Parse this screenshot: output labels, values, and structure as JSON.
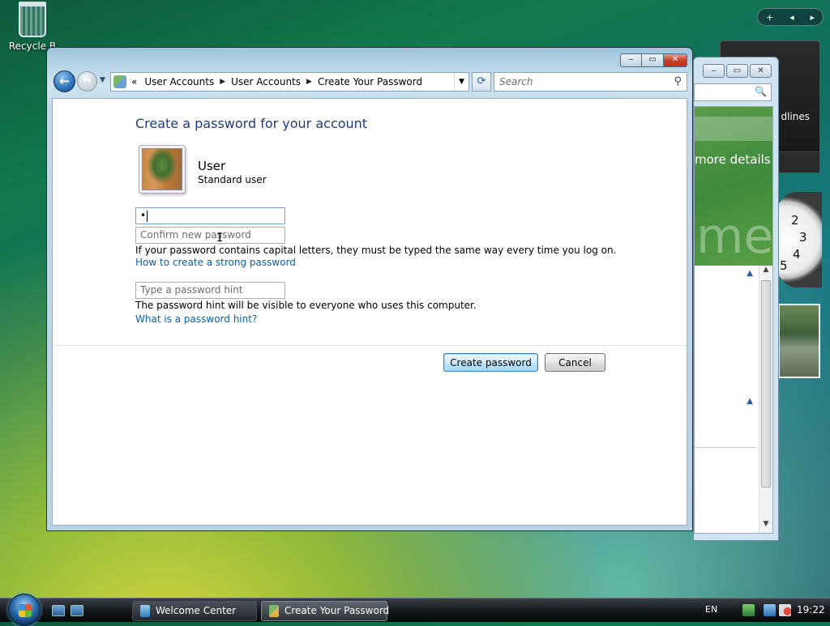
{
  "desktop": {
    "recycle_bin_label": "Recycle B"
  },
  "gadgets": {
    "feed_label": "dlines",
    "clock_numbers": [
      "2",
      "3",
      "4",
      "5"
    ]
  },
  "background_window": {
    "title": "Welcome Center",
    "more_details": "more details",
    "big_text": "me",
    "controls": {
      "min": "‒",
      "max": "▭",
      "close": "✕"
    },
    "search_icon": "🔍"
  },
  "window": {
    "controls": {
      "min": "‒",
      "max": "▭",
      "close": "✕"
    },
    "nav": {
      "back": "←",
      "forward": "→",
      "history": "▼"
    },
    "address": {
      "overflow": "«",
      "segments": [
        "User Accounts",
        "User Accounts",
        "Create Your Password"
      ],
      "separator": "▶",
      "dropdown": "▼"
    },
    "refresh": "⟳",
    "search": {
      "placeholder": "Search",
      "icon": "⚲"
    }
  },
  "page": {
    "title": "Create a password for your account",
    "user": {
      "name": "User",
      "type": "Standard user"
    },
    "new_password": {
      "value": "•"
    },
    "confirm_password": {
      "placeholder": "Confirm new password",
      "value": ""
    },
    "caps_note": "If your password contains capital letters, they must be typed the same way every time you log on.",
    "strong_password_link": "How to create a strong password",
    "hint": {
      "placeholder": "Type a password hint",
      "value": ""
    },
    "hint_note": "The password hint will be visible to everyone who uses this computer.",
    "hint_link": "What is a password hint?",
    "buttons": {
      "create": "Create password",
      "cancel": "Cancel"
    }
  },
  "taskbar": {
    "items": [
      {
        "label": "Welcome Center",
        "active": false
      },
      {
        "label": "Create Your Password",
        "active": true
      }
    ],
    "language": "EN",
    "time": "19:22"
  },
  "colors": {
    "title_blue": "#1e3b7a",
    "link_blue": "#0b5fa8",
    "close_red": "#c94128"
  },
  "sidebar_controls": {
    "add": "+",
    "prev": "◂",
    "next": "▸"
  }
}
